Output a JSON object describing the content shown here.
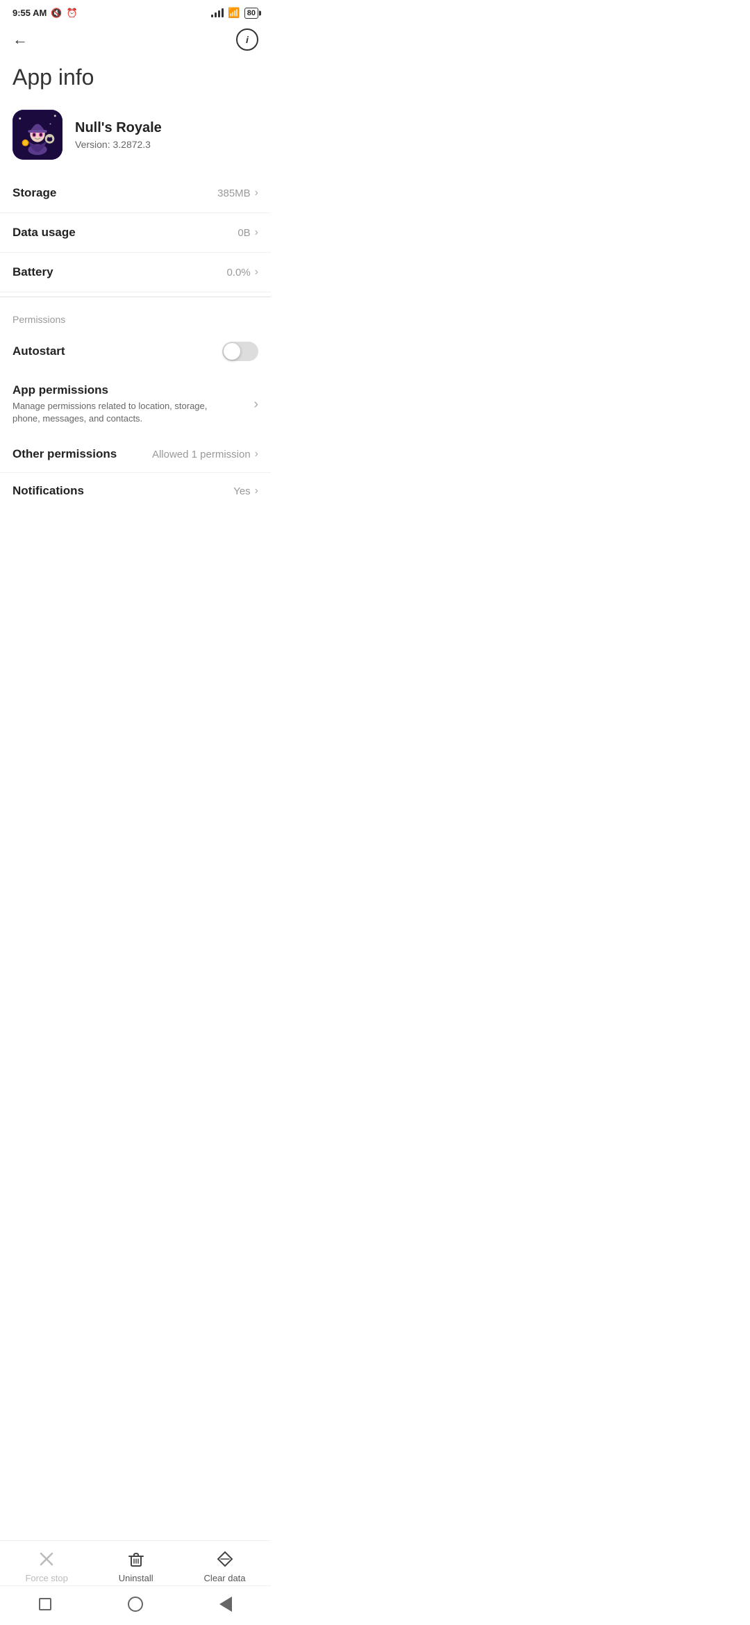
{
  "statusBar": {
    "time": "9:55 AM",
    "muteIcon": "🔇",
    "alarmIcon": "⏰",
    "batteryLevel": "80",
    "wifiStrength": 4,
    "signalStrength": 4
  },
  "nav": {
    "backLabel": "←",
    "infoLabel": "i"
  },
  "pageTitle": "App info",
  "app": {
    "name": "Null's Royale",
    "version": "Version: 3.2872.3"
  },
  "rows": {
    "storage": {
      "label": "Storage",
      "value": "385MB"
    },
    "dataUsage": {
      "label": "Data usage",
      "value": "0B"
    },
    "battery": {
      "label": "Battery",
      "value": "0.0%"
    }
  },
  "permissions": {
    "sectionLabel": "Permissions",
    "autostart": {
      "label": "Autostart",
      "enabled": false
    },
    "appPermissions": {
      "title": "App permissions",
      "description": "Manage permissions related to location, storage, phone, messages, and contacts."
    },
    "otherPermissions": {
      "label": "Other permissions",
      "value": "Allowed 1 permission"
    },
    "notifications": {
      "label": "Notifications",
      "value": "Yes"
    }
  },
  "bottomBar": {
    "forceStop": {
      "label": "Force stop",
      "disabled": true
    },
    "uninstall": {
      "label": "Uninstall",
      "disabled": false
    },
    "clearData": {
      "label": "Clear data",
      "disabled": false
    }
  }
}
